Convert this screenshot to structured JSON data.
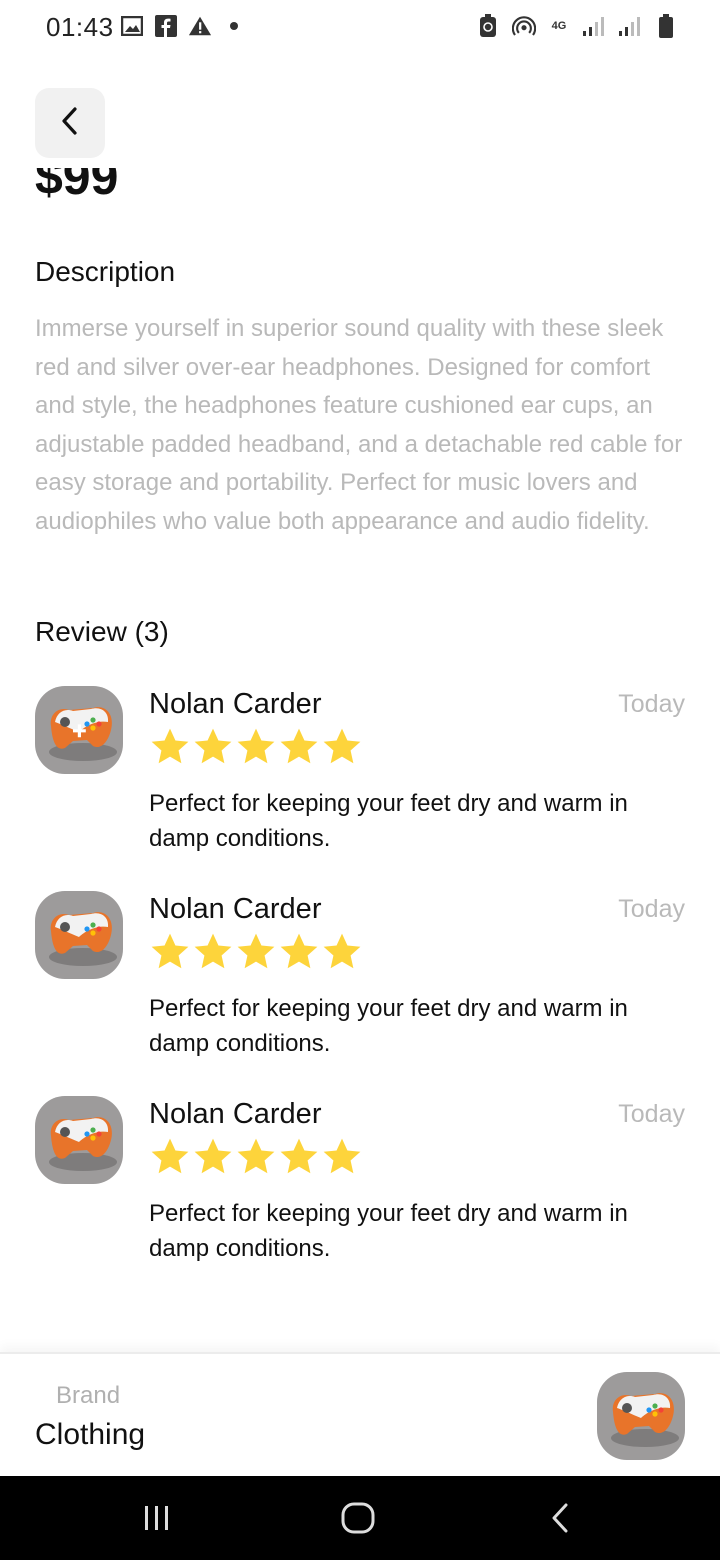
{
  "status_bar": {
    "time": "01:43",
    "left_icons": [
      "image-icon",
      "facebook-icon",
      "warning-icon",
      "dot-icon"
    ],
    "right_icons": [
      "battery-saver-icon",
      "hotspot-icon",
      "4g-icon",
      "signal-icon",
      "signal-icon",
      "battery-icon"
    ],
    "network_label": "4G"
  },
  "product": {
    "price_partial": "$99"
  },
  "description": {
    "title": "Description",
    "body": "Immerse yourself in superior sound quality with these sleek red and silver over-ear headphones. Designed for comfort and style, the headphones feature cushioned ear cups, an adjustable padded headband, and a detachable red cable for easy storage and portability. Perfect for music lovers and audiophiles who value both appearance and audio fidelity."
  },
  "reviews": {
    "title": "Review (3)",
    "items": [
      {
        "name": "Nolan Carder",
        "date": "Today",
        "rating": 5,
        "text": "Perfect for keeping your feet dry and warm in damp conditions."
      },
      {
        "name": "Nolan Carder",
        "date": "Today",
        "rating": 5,
        "text": "Perfect for keeping your feet dry and warm in damp conditions."
      },
      {
        "name": "Nolan Carder",
        "date": "Today",
        "rating": 5,
        "text": "Perfect for keeping your feet dry and warm in damp conditions."
      }
    ]
  },
  "brand": {
    "label": "Brand",
    "value": "Clothing"
  },
  "colors": {
    "star": "#FDD43B",
    "muted_text": "#B9B9B9",
    "avatar_bg": "#9D9B9B",
    "controller_orange": "#E8742A"
  },
  "nav_bar": {
    "icons": [
      "recent-apps-icon",
      "home-icon",
      "back-icon"
    ]
  }
}
